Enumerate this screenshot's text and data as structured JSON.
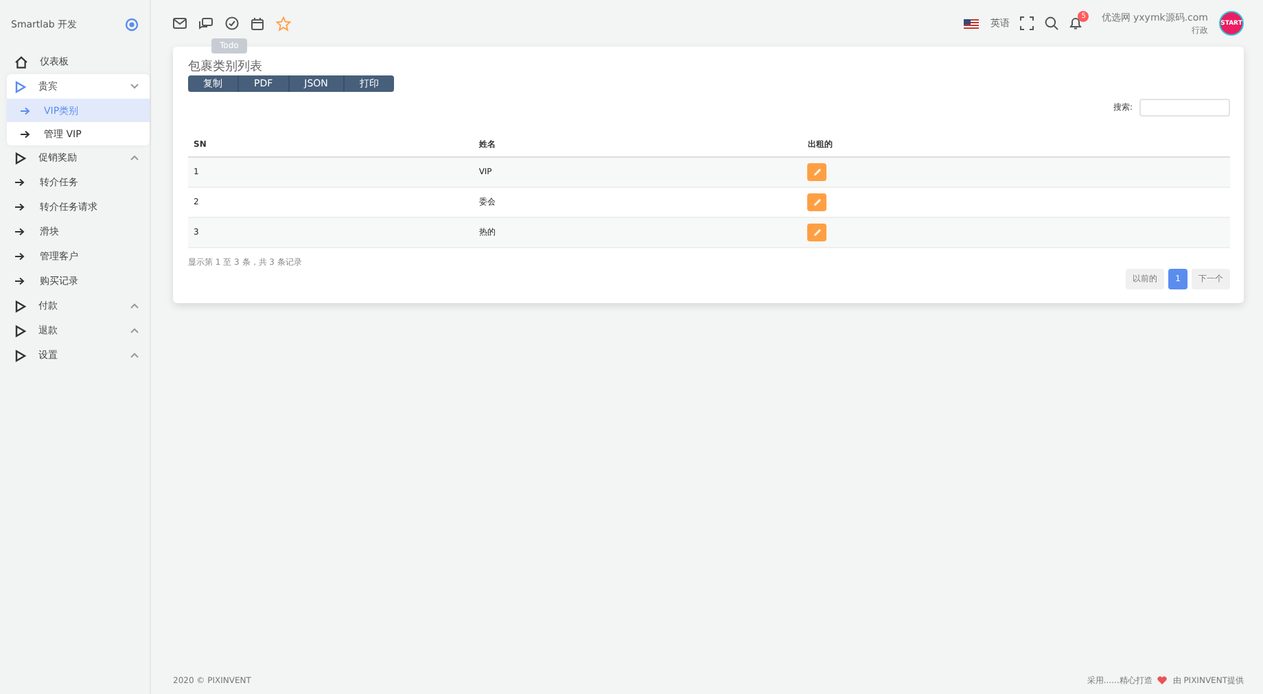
{
  "brand": "Smartlab 开发",
  "sidebar": {
    "items": [
      {
        "kind": "home",
        "label": "仪表板"
      },
      {
        "kind": "group",
        "label": "贵宾",
        "expanded": true,
        "children": [
          {
            "label": "VIP类别",
            "selected": true
          },
          {
            "label": "管理 VIP",
            "selected": false
          }
        ]
      },
      {
        "kind": "group",
        "label": "促销奖励",
        "expanded": false
      },
      {
        "kind": "link",
        "label": "转介任务"
      },
      {
        "kind": "link",
        "label": "转介任务请求"
      },
      {
        "kind": "link",
        "label": "滑块"
      },
      {
        "kind": "link",
        "label": "管理客户"
      },
      {
        "kind": "link",
        "label": "购买记录"
      },
      {
        "kind": "group",
        "label": "付款",
        "expanded": false
      },
      {
        "kind": "group",
        "label": "退款",
        "expanded": false
      },
      {
        "kind": "group",
        "label": "设置",
        "expanded": false
      }
    ]
  },
  "header": {
    "tooltip": "Todo",
    "language": "英语",
    "notification_count": "5",
    "user_name": "优选网 yxymk源码.com",
    "user_role": "行政",
    "avatar_text": "START"
  },
  "card": {
    "title": "包裹类别列表",
    "export_buttons": [
      "复制",
      "PDF",
      "JSON",
      "打印"
    ],
    "search_label": "搜索:",
    "table": {
      "columns": [
        "SN",
        "姓名",
        "出租的"
      ],
      "rows": [
        [
          "1",
          "VIP"
        ],
        [
          "2",
          "委会"
        ],
        [
          "3",
          "热的"
        ]
      ]
    },
    "info": "显示第 1 至 3 条，共 3 条记录",
    "pagination": {
      "previous": "以前的",
      "pages": [
        {
          "label": "1",
          "selected": true
        }
      ],
      "next": "下一个"
    }
  },
  "footer": {
    "left": "2020 © PIXINVENT",
    "right_before": "采用......精心打造",
    "right_after": "由 PIXINVENT提供"
  }
}
